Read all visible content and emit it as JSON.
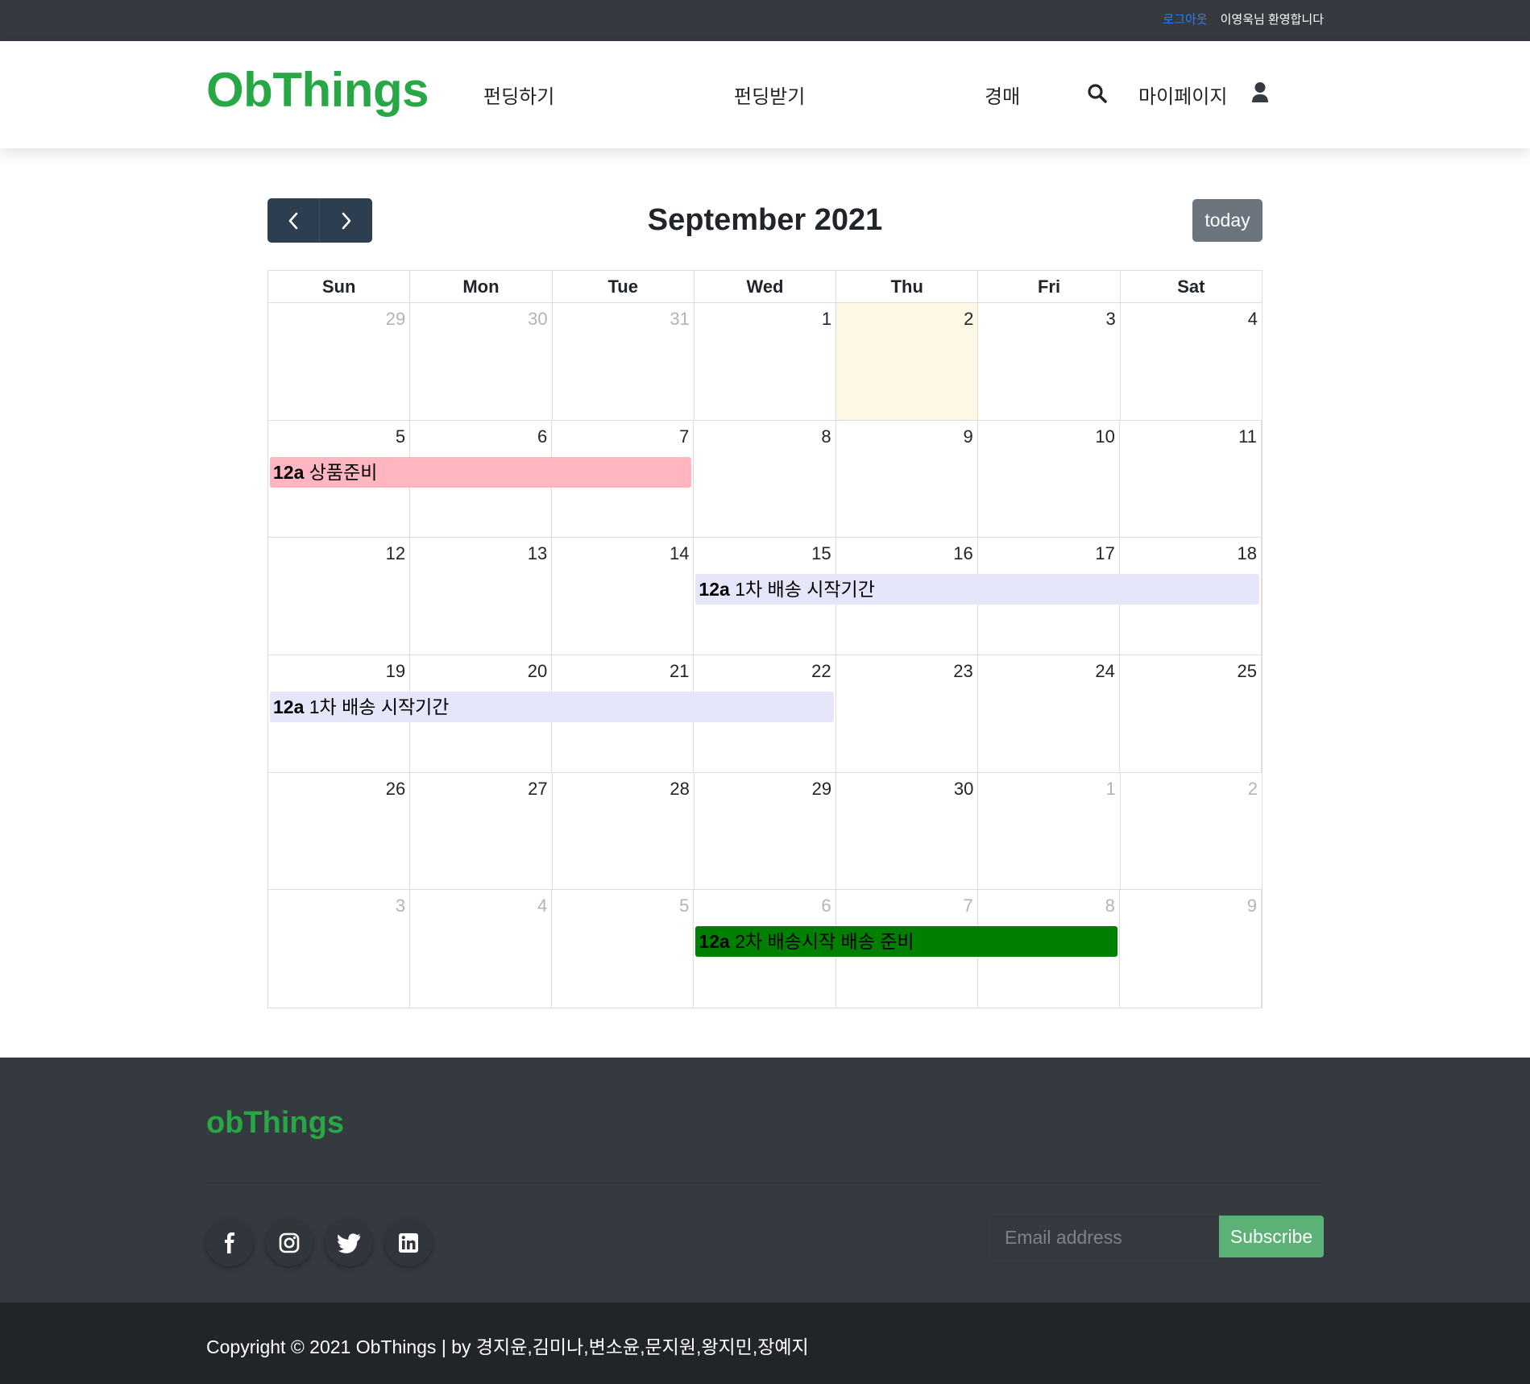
{
  "topbar": {
    "logout": "로그아웃",
    "welcome": "이영욱님 환영합니다"
  },
  "header": {
    "brand": "ObThings",
    "nav": {
      "funding": "펀딩하기",
      "receive": "펀딩받기",
      "auction": "경매",
      "mypage": "마이페이지"
    },
    "icons": {
      "search": "search-icon",
      "user": "user-icon"
    }
  },
  "calendar": {
    "title": "September 2021",
    "today_label": "today",
    "days_of_week": [
      "Sun",
      "Mon",
      "Tue",
      "Wed",
      "Thu",
      "Fri",
      "Sat"
    ],
    "weeks": [
      [
        {
          "d": "29",
          "o": true
        },
        {
          "d": "30",
          "o": true
        },
        {
          "d": "31",
          "o": true
        },
        {
          "d": "1"
        },
        {
          "d": "2",
          "today": true
        },
        {
          "d": "3"
        },
        {
          "d": "4"
        }
      ],
      [
        {
          "d": "5"
        },
        {
          "d": "6"
        },
        {
          "d": "7"
        },
        {
          "d": "8"
        },
        {
          "d": "9"
        },
        {
          "d": "10"
        },
        {
          "d": "11"
        }
      ],
      [
        {
          "d": "12"
        },
        {
          "d": "13"
        },
        {
          "d": "14"
        },
        {
          "d": "15"
        },
        {
          "d": "16"
        },
        {
          "d": "17"
        },
        {
          "d": "18"
        }
      ],
      [
        {
          "d": "19"
        },
        {
          "d": "20"
        },
        {
          "d": "21"
        },
        {
          "d": "22"
        },
        {
          "d": "23"
        },
        {
          "d": "24"
        },
        {
          "d": "25"
        }
      ],
      [
        {
          "d": "26"
        },
        {
          "d": "27"
        },
        {
          "d": "28"
        },
        {
          "d": "29"
        },
        {
          "d": "30"
        },
        {
          "d": "1",
          "o": true
        },
        {
          "d": "2",
          "o": true
        }
      ],
      [
        {
          "d": "3",
          "o": true
        },
        {
          "d": "4",
          "o": true
        },
        {
          "d": "5",
          "o": true
        },
        {
          "d": "6",
          "o": true
        },
        {
          "d": "7",
          "o": true
        },
        {
          "d": "8",
          "o": true
        },
        {
          "d": "9",
          "o": true
        }
      ]
    ],
    "events": [
      {
        "week": 1,
        "start": 0,
        "end": 2,
        "time": "12a",
        "title": "상품준비",
        "color": "#ffb6c1"
      },
      {
        "week": 2,
        "start": 3,
        "end": 6,
        "time": "12a",
        "title": "1차 배송 시작기간",
        "color": "#e6e6fa"
      },
      {
        "week": 3,
        "start": 0,
        "end": 3,
        "time": "12a",
        "title": "1차 배송 시작기간",
        "color": "#e6e6fa"
      },
      {
        "week": 5,
        "start": 3,
        "end": 5,
        "time": "12a",
        "title": "2차 배송시작 배송 준비",
        "color": "#008000"
      }
    ],
    "today_color": "#fcf8e3"
  },
  "footer": {
    "brand": "obThings",
    "social": [
      "facebook-icon",
      "instagram-icon",
      "twitter-icon",
      "linkedin-icon"
    ],
    "email_placeholder": "Email address",
    "subscribe_label": "Subscribe",
    "copyright": "Copyright © 2021 ObThings | by 경지윤,김미나,변소윤,문지원,왕지민,장예지"
  },
  "colors": {
    "brand_green": "#28a745",
    "dark": "#343a40",
    "darker": "#212529",
    "nav_button": "#2c3e50",
    "today_button": "#6c757d",
    "subscribe": "#5cb176"
  }
}
